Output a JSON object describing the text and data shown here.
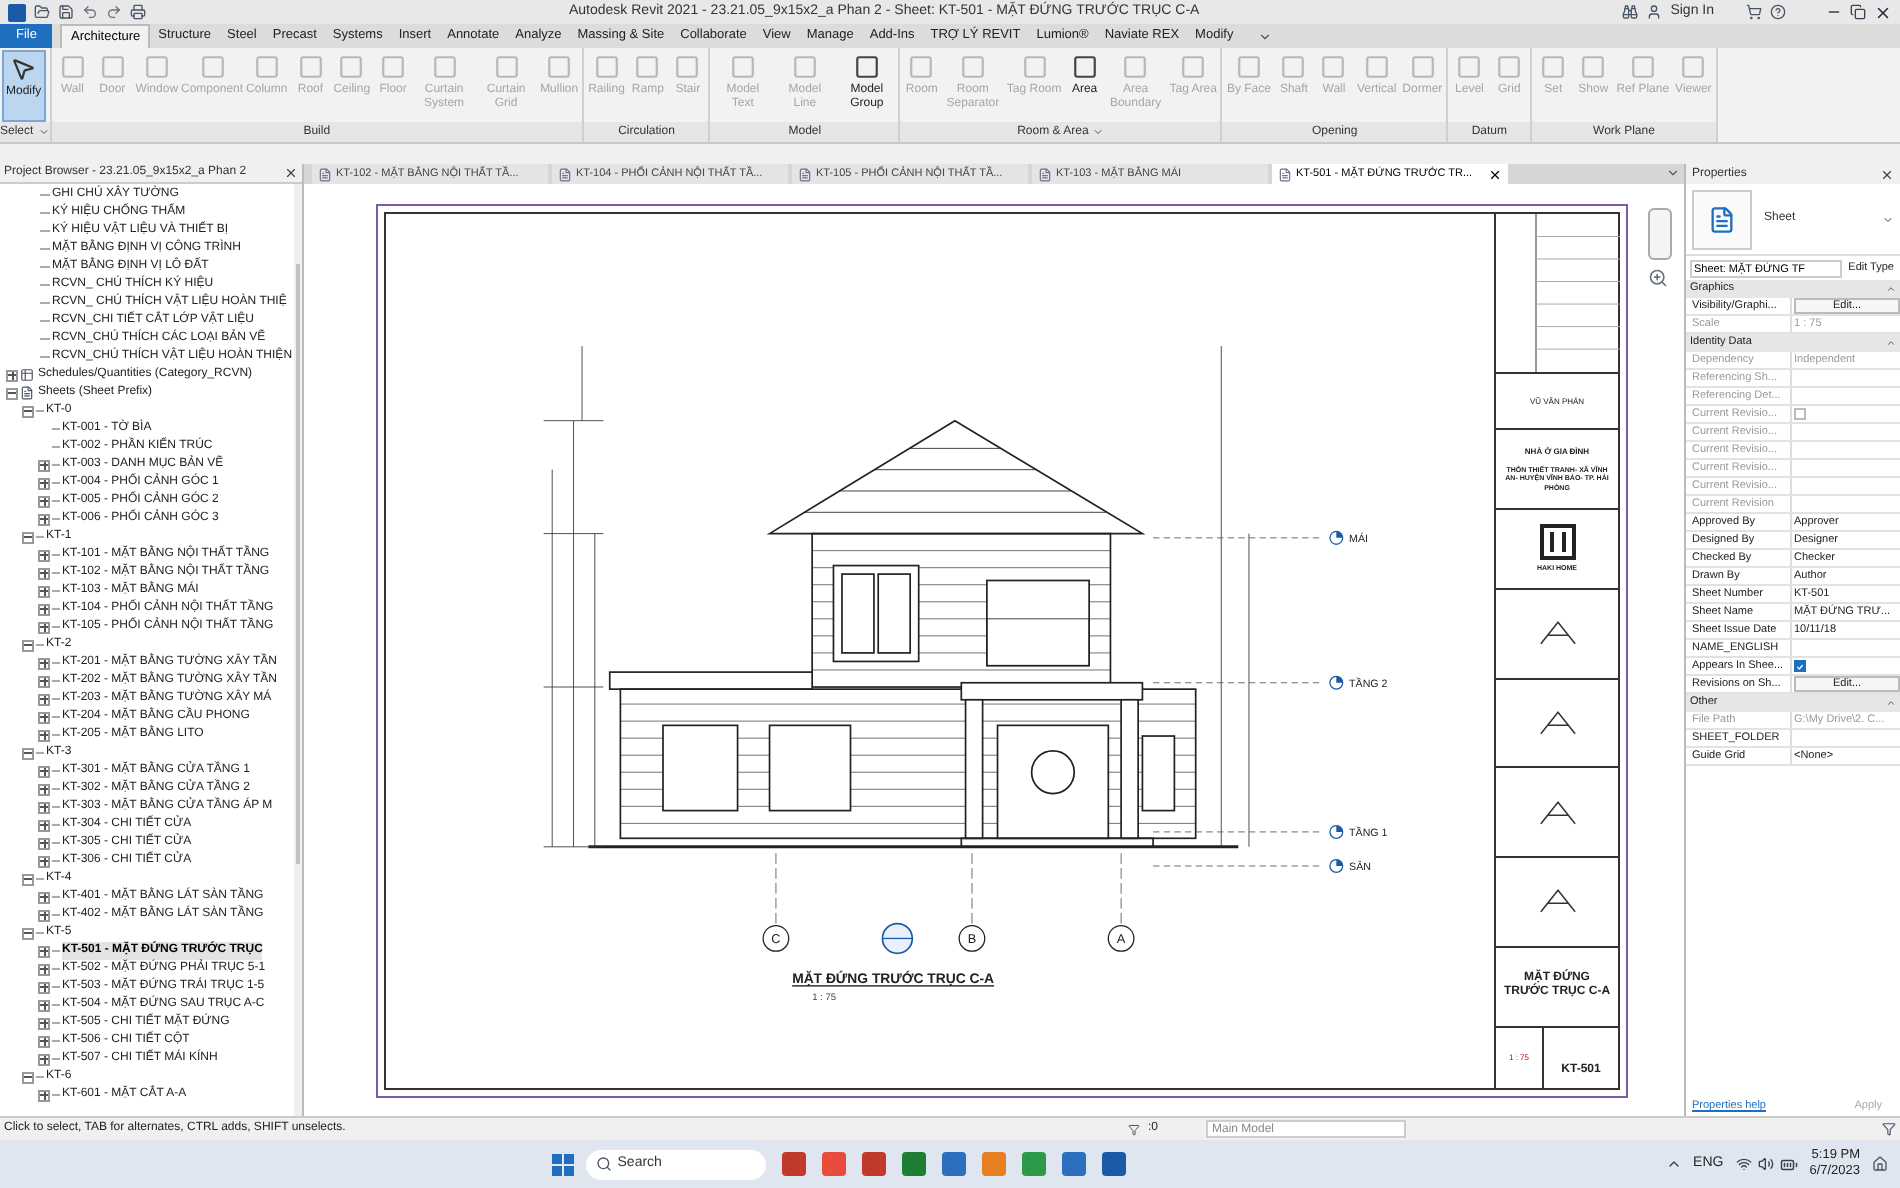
{
  "title_bar": {
    "title": "Autodesk Revit 2021 - 23.21.05_9x15x2_a Phan 2 - Sheet: KT-501 - MẶT ĐỨNG TRƯỚC TRỤC C-A",
    "sign_in": "Sign In"
  },
  "ribbon_tabs": [
    {
      "label": "File",
      "selected": false,
      "kind": "file"
    },
    {
      "label": "Architecture",
      "selected": true,
      "kind": "tab"
    },
    {
      "label": "Structure",
      "selected": false,
      "kind": "tab"
    },
    {
      "label": "Steel",
      "selected": false,
      "kind": "tab"
    },
    {
      "label": "Precast",
      "selected": false,
      "kind": "tab"
    },
    {
      "label": "Systems",
      "selected": false,
      "kind": "tab"
    },
    {
      "label": "Insert",
      "selected": false,
      "kind": "tab"
    },
    {
      "label": "Annotate",
      "selected": false,
      "kind": "tab"
    },
    {
      "label": "Analyze",
      "selected": false,
      "kind": "tab"
    },
    {
      "label": "Massing & Site",
      "selected": false,
      "kind": "tab"
    },
    {
      "label": "Collaborate",
      "selected": false,
      "kind": "tab"
    },
    {
      "label": "View",
      "selected": false,
      "kind": "tab"
    },
    {
      "label": "Manage",
      "selected": false,
      "kind": "tab"
    },
    {
      "label": "Add-Ins",
      "selected": false,
      "kind": "tab"
    },
    {
      "label": "TRỢ LÝ REVIT",
      "selected": false,
      "kind": "tab"
    },
    {
      "label": "Lumion®",
      "selected": false,
      "kind": "tab"
    },
    {
      "label": "Naviate REX",
      "selected": false,
      "kind": "tab"
    },
    {
      "label": "Modify",
      "selected": false,
      "kind": "tab"
    }
  ],
  "ribbon_groups": [
    {
      "label": "Select",
      "dropdown": true,
      "tools": [
        {
          "label": "Modify",
          "selected": true,
          "disabled": false
        }
      ]
    },
    {
      "label": "Build",
      "dropdown": false,
      "tools": [
        {
          "label": "Wall",
          "selected": false,
          "disabled": true
        },
        {
          "label": "Door",
          "selected": false,
          "disabled": true
        },
        {
          "label": "Window",
          "selected": false,
          "disabled": true
        },
        {
          "label": "Component",
          "selected": false,
          "disabled": true
        },
        {
          "label": "Column",
          "selected": false,
          "disabled": true
        },
        {
          "label": "Roof",
          "selected": false,
          "disabled": true
        },
        {
          "label": "Ceiling",
          "selected": false,
          "disabled": true
        },
        {
          "label": "Floor",
          "selected": false,
          "disabled": true
        },
        {
          "label": "Curtain System",
          "selected": false,
          "disabled": true
        },
        {
          "label": "Curtain Grid",
          "selected": false,
          "disabled": true
        },
        {
          "label": "Mullion",
          "selected": false,
          "disabled": true
        }
      ]
    },
    {
      "label": "Circulation",
      "dropdown": false,
      "tools": [
        {
          "label": "Railing",
          "selected": false,
          "disabled": true
        },
        {
          "label": "Ramp",
          "selected": false,
          "disabled": true
        },
        {
          "label": "Stair",
          "selected": false,
          "disabled": true
        }
      ]
    },
    {
      "label": "Model",
      "dropdown": false,
      "tools": [
        {
          "label": "Model Text",
          "selected": false,
          "disabled": true
        },
        {
          "label": "Model Line",
          "selected": false,
          "disabled": true
        },
        {
          "label": "Model Group",
          "selected": false,
          "disabled": false
        }
      ]
    },
    {
      "label": "Room & Area",
      "dropdown": true,
      "tools": [
        {
          "label": "Room",
          "selected": false,
          "disabled": true
        },
        {
          "label": "Room Separator",
          "selected": false,
          "disabled": true
        },
        {
          "label": "Tag Room",
          "selected": false,
          "disabled": true
        },
        {
          "label": "Area",
          "selected": false,
          "disabled": false
        },
        {
          "label": "Area Boundary",
          "selected": false,
          "disabled": true
        },
        {
          "label": "Tag Area",
          "selected": false,
          "disabled": true
        }
      ]
    },
    {
      "label": "Opening",
      "dropdown": false,
      "tools": [
        {
          "label": "By Face",
          "selected": false,
          "disabled": true
        },
        {
          "label": "Shaft",
          "selected": false,
          "disabled": true
        },
        {
          "label": "Wall",
          "selected": false,
          "disabled": true
        },
        {
          "label": "Vertical",
          "selected": false,
          "disabled": true
        },
        {
          "label": "Dormer",
          "selected": false,
          "disabled": true
        }
      ]
    },
    {
      "label": "Datum",
      "dropdown": false,
      "tools": [
        {
          "label": "Level",
          "selected": false,
          "disabled": true
        },
        {
          "label": "Grid",
          "selected": false,
          "disabled": true
        }
      ]
    },
    {
      "label": "Work Plane",
      "dropdown": false,
      "tools": [
        {
          "label": "Set",
          "selected": false,
          "disabled": true
        },
        {
          "label": "Show",
          "selected": false,
          "disabled": true
        },
        {
          "label": "Ref Plane",
          "selected": false,
          "disabled": true
        },
        {
          "label": "Viewer",
          "selected": false,
          "disabled": true
        }
      ]
    }
  ],
  "project_browser": {
    "title": "Project Browser - 23.21.05_9x15x2_a Phan 2",
    "continued_items": [
      {
        "label": "GHI CHÚ XÂY TƯỜNG",
        "selected": false
      },
      {
        "label": "KÝ HIỆU CHỐNG THẤM",
        "selected": false
      },
      {
        "label": "KÝ HIỆU VẬT LIỆU VÀ THIẾT BỊ",
        "selected": false
      },
      {
        "label": "MẶT BẰNG ĐỊNH VỊ CÔNG TRÌNH",
        "selected": false
      },
      {
        "label": "MẶT BẰNG ĐỊNH VỊ LÔ ĐẤT",
        "selected": false
      },
      {
        "label": "RCVN_ CHÚ THÍCH KÝ HIỆU",
        "selected": false
      },
      {
        "label": "RCVN_ CHÚ THÍCH VẬT LIỆU HOÀN THIỆ",
        "selected": false
      },
      {
        "label": "RCVN_CHI TIẾT CẮT LỚP VẬT LIỆU",
        "selected": false
      },
      {
        "label": "RCVN_CHÚ THÍCH CÁC LOẠI BẢN VẼ",
        "selected": false
      },
      {
        "label": "RCVN_CHÚ THÍCH VẬT LIỆU HOÀN THIỆN",
        "selected": false
      }
    ],
    "tree": [
      {
        "label": "Schedules/Quantities (Category_RCVN)",
        "expanded": false,
        "selected": false
      },
      {
        "label": "Sheets (Sheet Prefix)",
        "expanded": true,
        "selected": false,
        "children": [
          {
            "label": "KT-0",
            "expanded": true,
            "selected": false,
            "children": [
              {
                "label": "KT-001 - TỜ BÌA",
                "selected": false
              },
              {
                "label": "KT-002 - PHẦN KIẾN TRÚC",
                "selected": false
              },
              {
                "label": "KT-003 - DANH MỤC BẢN VẼ",
                "expanded": false,
                "selected": false
              },
              {
                "label": "KT-004 - PHỐI CẢNH GÓC 1",
                "expanded": false,
                "selected": false
              },
              {
                "label": "KT-005 - PHỐI CẢNH GÓC 2",
                "expanded": false,
                "selected": false
              },
              {
                "label": "KT-006 - PHỐI CẢNH GÓC 3",
                "expanded": false,
                "selected": false
              }
            ]
          },
          {
            "label": "KT-1",
            "expanded": true,
            "selected": false,
            "children": [
              {
                "label": "KT-101 - MẶT BẰNG NỘI THẤT TẦNG",
                "expanded": false,
                "selected": false
              },
              {
                "label": "KT-102 - MẶT BẰNG NỘI THẤT TẦNG",
                "expanded": false,
                "selected": false
              },
              {
                "label": "KT-103 - MẶT BẰNG MÁI",
                "expanded": false,
                "selected": false
              },
              {
                "label": "KT-104 - PHỐI CẢNH NỘI THẤT TẦNG",
                "expanded": false,
                "selected": false
              },
              {
                "label": "KT-105 - PHỐI CẢNH NỘI THẤT TẦNG",
                "expanded": false,
                "selected": false
              }
            ]
          },
          {
            "label": "KT-2",
            "expanded": true,
            "selected": false,
            "children": [
              {
                "label": "KT-201 - MẶT BẰNG TƯỜNG XÂY TẦN",
                "expanded": false,
                "selected": false
              },
              {
                "label": "KT-202 - MẶT BẰNG TƯỜNG XÂY TẦN",
                "expanded": false,
                "selected": false
              },
              {
                "label": "KT-203 - MẶT BẰNG TƯỜNG XÂY MÁ",
                "expanded": false,
                "selected": false
              },
              {
                "label": "KT-204 - MẶT BẰNG CẦU PHONG",
                "expanded": false,
                "selected": false
              },
              {
                "label": "KT-205 - MẶT BẰNG LITO",
                "expanded": false,
                "selected": false
              }
            ]
          },
          {
            "label": "KT-3",
            "expanded": true,
            "selected": false,
            "children": [
              {
                "label": "KT-301 - MẶT BẰNG CỬA TẦNG 1",
                "expanded": false,
                "selected": false
              },
              {
                "label": "KT-302 - MẶT BẰNG CỬA TẦNG 2",
                "expanded": false,
                "selected": false
              },
              {
                "label": "KT-303 - MẶT BẰNG CỬA TẦNG ÁP M",
                "expanded": false,
                "selected": false
              },
              {
                "label": "KT-304 - CHI TIẾT CỬA",
                "expanded": false,
                "selected": false
              },
              {
                "label": "KT-305 - CHI TIẾT CỬA",
                "expanded": false,
                "selected": false
              },
              {
                "label": "KT-306 - CHI TIẾT CỬA",
                "expanded": false,
                "selected": false
              }
            ]
          },
          {
            "label": "KT-4",
            "expanded": true,
            "selected": false,
            "children": [
              {
                "label": "KT-401 - MẶT BẰNG LÁT SÀN TẦNG",
                "expanded": false,
                "selected": false
              },
              {
                "label": "KT-402 - MẶT BẰNG LÁT SÀN TẦNG",
                "expanded": false,
                "selected": false
              }
            ]
          },
          {
            "label": "KT-5",
            "expanded": true,
            "selected": false,
            "children": [
              {
                "label": "KT-501 - MẶT ĐỨNG TRƯỚC TRỤC",
                "expanded": false,
                "selected": true
              },
              {
                "label": "KT-502 - MẶT ĐỨNG PHẢI TRỤC 5-1",
                "expanded": false,
                "selected": false
              },
              {
                "label": "KT-503 - MẶT ĐỨNG TRÁI TRỤC 1-5",
                "expanded": false,
                "selected": false
              },
              {
                "label": "KT-504 - MẶT ĐỨNG SAU TRỤC A-C",
                "expanded": false,
                "selected": false
              },
              {
                "label": "KT-505 - CHI TIẾT MẶT ĐỨNG",
                "expanded": false,
                "selected": false
              },
              {
                "label": "KT-506 - CHI TIẾT CỘT",
                "expanded": false,
                "selected": false
              },
              {
                "label": "KT-507 - CHI TIẾT MÁI KÍNH",
                "expanded": false,
                "selected": false
              }
            ]
          },
          {
            "label": "KT-6",
            "expanded": true,
            "selected": false,
            "children": [
              {
                "label": "KT-601 - MẶT CẮT A-A",
                "expanded": false,
                "selected": false
              }
            ]
          }
        ]
      }
    ]
  },
  "view_tabs": [
    {
      "label": "KT-102 - MẶT BẰNG NỘI THẤT TẦ...",
      "selected": false
    },
    {
      "label": "KT-104 - PHỐI CẢNH NỘI THẤT TẦ...",
      "selected": false
    },
    {
      "label": "KT-105 - PHỐI CẢNH NỘI THẤT TẦ...",
      "selected": false
    },
    {
      "label": "KT-103 - MẶT BẰNG MÁI",
      "selected": false
    },
    {
      "label": "KT-501 - MẶT ĐỨNG TRƯỚC TR...",
      "selected": true
    }
  ],
  "sheet": {
    "view_title": "MẶT ĐỨNG TRƯỚC TRỤC C-A",
    "view_scale": "1 : 75",
    "levels": [
      {
        "name": "MÁI"
      },
      {
        "name": "TẦNG 2"
      },
      {
        "name": "TẦNG 1"
      },
      {
        "name": "SÂN"
      }
    ],
    "grids": [
      {
        "label": "C"
      },
      {
        "label": "B"
      },
      {
        "label": "A"
      }
    ],
    "title_block": {
      "designer": "VŨ VĂN PHÁN",
      "project": "NHÀ Ở GIA ĐÌNH",
      "address": "THÔN THIẾT TRANH- XÃ VĨNH AN- HUYỆN VĨNH BẢO- TP. HẢI PHÒNG",
      "brand": "HAKI HOME",
      "sheet_name": "MẶT ĐỨNG TRƯỚC TRỤC C-A",
      "scale": "1 : 75",
      "sheet_number": "KT-501"
    }
  },
  "properties": {
    "title": "Properties",
    "type": "Sheet",
    "selector": "Sheet: MẶT ĐỨNG TF",
    "edit_type": "Edit Type",
    "groups": [
      {
        "name": "Graphics",
        "rows": [
          {
            "label": "Visibility/Graphi...",
            "kind": "button",
            "value": "Edit...",
            "disabled": false
          },
          {
            "label": "Scale",
            "kind": "text",
            "value": "1 : 75",
            "disabled": true
          }
        ]
      },
      {
        "name": "Identity Data",
        "rows": [
          {
            "label": "Dependency",
            "kind": "text",
            "value": "Independent",
            "disabled": true
          },
          {
            "label": "Referencing Sh...",
            "kind": "text",
            "disabled": true
          },
          {
            "label": "Referencing Det...",
            "kind": "text",
            "disabled": true
          },
          {
            "label": "Current Revisio...",
            "kind": "checkbox",
            "checked": false,
            "disabled": true
          },
          {
            "label": "Current Revisio...",
            "kind": "text",
            "disabled": true
          },
          {
            "label": "Current Revisio...",
            "kind": "text",
            "disabled": true
          },
          {
            "label": "Current Revisio...",
            "kind": "text",
            "disabled": true
          },
          {
            "label": "Current Revisio...",
            "kind": "text",
            "disabled": true
          },
          {
            "label": "Current Revision",
            "kind": "text",
            "disabled": true
          },
          {
            "label": "Approved By",
            "kind": "text",
            "value": "Approver",
            "disabled": false
          },
          {
            "label": "Designed By",
            "kind": "text",
            "value": "Designer",
            "disabled": false
          },
          {
            "label": "Checked By",
            "kind": "text",
            "value": "Checker",
            "disabled": false
          },
          {
            "label": "Drawn By",
            "kind": "text",
            "value": "Author",
            "disabled": false
          },
          {
            "label": "Sheet Number",
            "kind": "text",
            "value": "KT-501",
            "disabled": false
          },
          {
            "label": "Sheet Name",
            "kind": "text",
            "value": "MẶT ĐỨNG TRƯ...",
            "disabled": false
          },
          {
            "label": "Sheet Issue Date",
            "kind": "text",
            "value": "10/11/18",
            "disabled": false
          },
          {
            "label": "NAME_ENGLISH",
            "kind": "text",
            "disabled": false
          },
          {
            "label": "Appears In Shee...",
            "kind": "checkbox",
            "checked": true,
            "disabled": false
          },
          {
            "label": "Revisions on Sh...",
            "kind": "button",
            "value": "Edit...",
            "disabled": false
          }
        ]
      },
      {
        "name": "Other",
        "rows": [
          {
            "label": "File Path",
            "kind": "text",
            "value": "G:\\My Drive\\2. C...",
            "disabled": true
          },
          {
            "label": "SHEET_FOLDER",
            "kind": "text",
            "disabled": false
          },
          {
            "label": "Guide Grid",
            "kind": "text",
            "value": "<None>",
            "disabled": false
          }
        ]
      }
    ],
    "help": "Properties help",
    "apply": "Apply"
  },
  "status_bar": {
    "message": "Click to select, TAB for alternates, CTRL adds, SHIFT unselects.",
    "count": ":0",
    "model": "Main Model"
  },
  "taskbar": {
    "search": "Search",
    "language": "ENG",
    "time": "5:19 PM",
    "date": "6/7/2023"
  }
}
